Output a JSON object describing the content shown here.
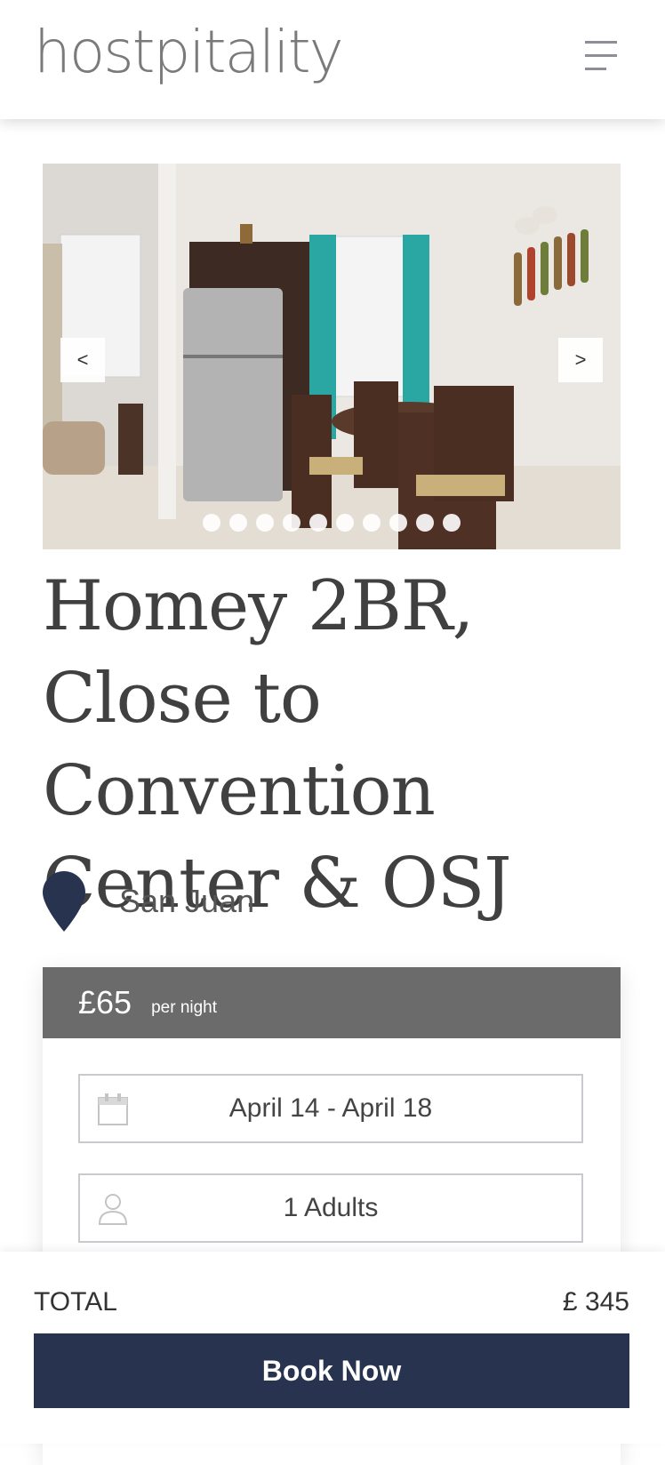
{
  "header": {
    "logo_text": "hostpitality",
    "menu_icon": "hamburger-menu-icon"
  },
  "gallery": {
    "prev_label": "<",
    "next_label": ">",
    "slide_count": 10,
    "active_slide": 1
  },
  "listing": {
    "title": "Homey 2BR, Close to Convention Center & OSJ",
    "location": "San Juan",
    "location_icon": "map-pin-icon"
  },
  "booking": {
    "price": "£65",
    "price_unit": "per night",
    "dates": "April 14 - April 18",
    "dates_icon": "calendar-icon",
    "guests": "1 Adults",
    "guests_icon": "person-icon"
  },
  "footer": {
    "total_label": "TOTAL",
    "total_value": "£ 345",
    "book_label": "Book Now"
  },
  "colors": {
    "primary": "#283350",
    "price_bar": "#6b6b6b",
    "text": "#404040"
  }
}
